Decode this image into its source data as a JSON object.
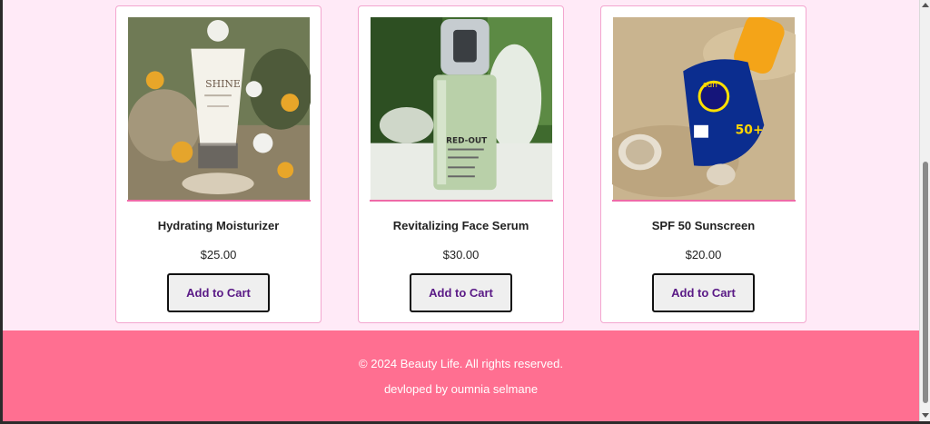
{
  "products": [
    {
      "name": "Hydrating Moisturizer",
      "price": "$25.00",
      "button_label": "Add to Cart",
      "image_icon": "moisturizer-tube-image"
    },
    {
      "name": "Revitalizing Face Serum",
      "price": "$30.00",
      "button_label": "Add to Cart",
      "image_icon": "serum-bottle-image"
    },
    {
      "name": "SPF 50 Sunscreen",
      "price": "$20.00",
      "button_label": "Add to Cart",
      "image_icon": "sunscreen-bottle-image"
    }
  ],
  "footer": {
    "copyright": "© 2024 Beauty Life. All rights reserved.",
    "developer": "devloped by oumnia selmane"
  },
  "colors": {
    "page_background": "#ffeaf7",
    "card_border": "#f3a6cf",
    "image_underline": "#ee6aa7",
    "button_text": "#5a1a86",
    "footer_background": "#ff6f91"
  }
}
